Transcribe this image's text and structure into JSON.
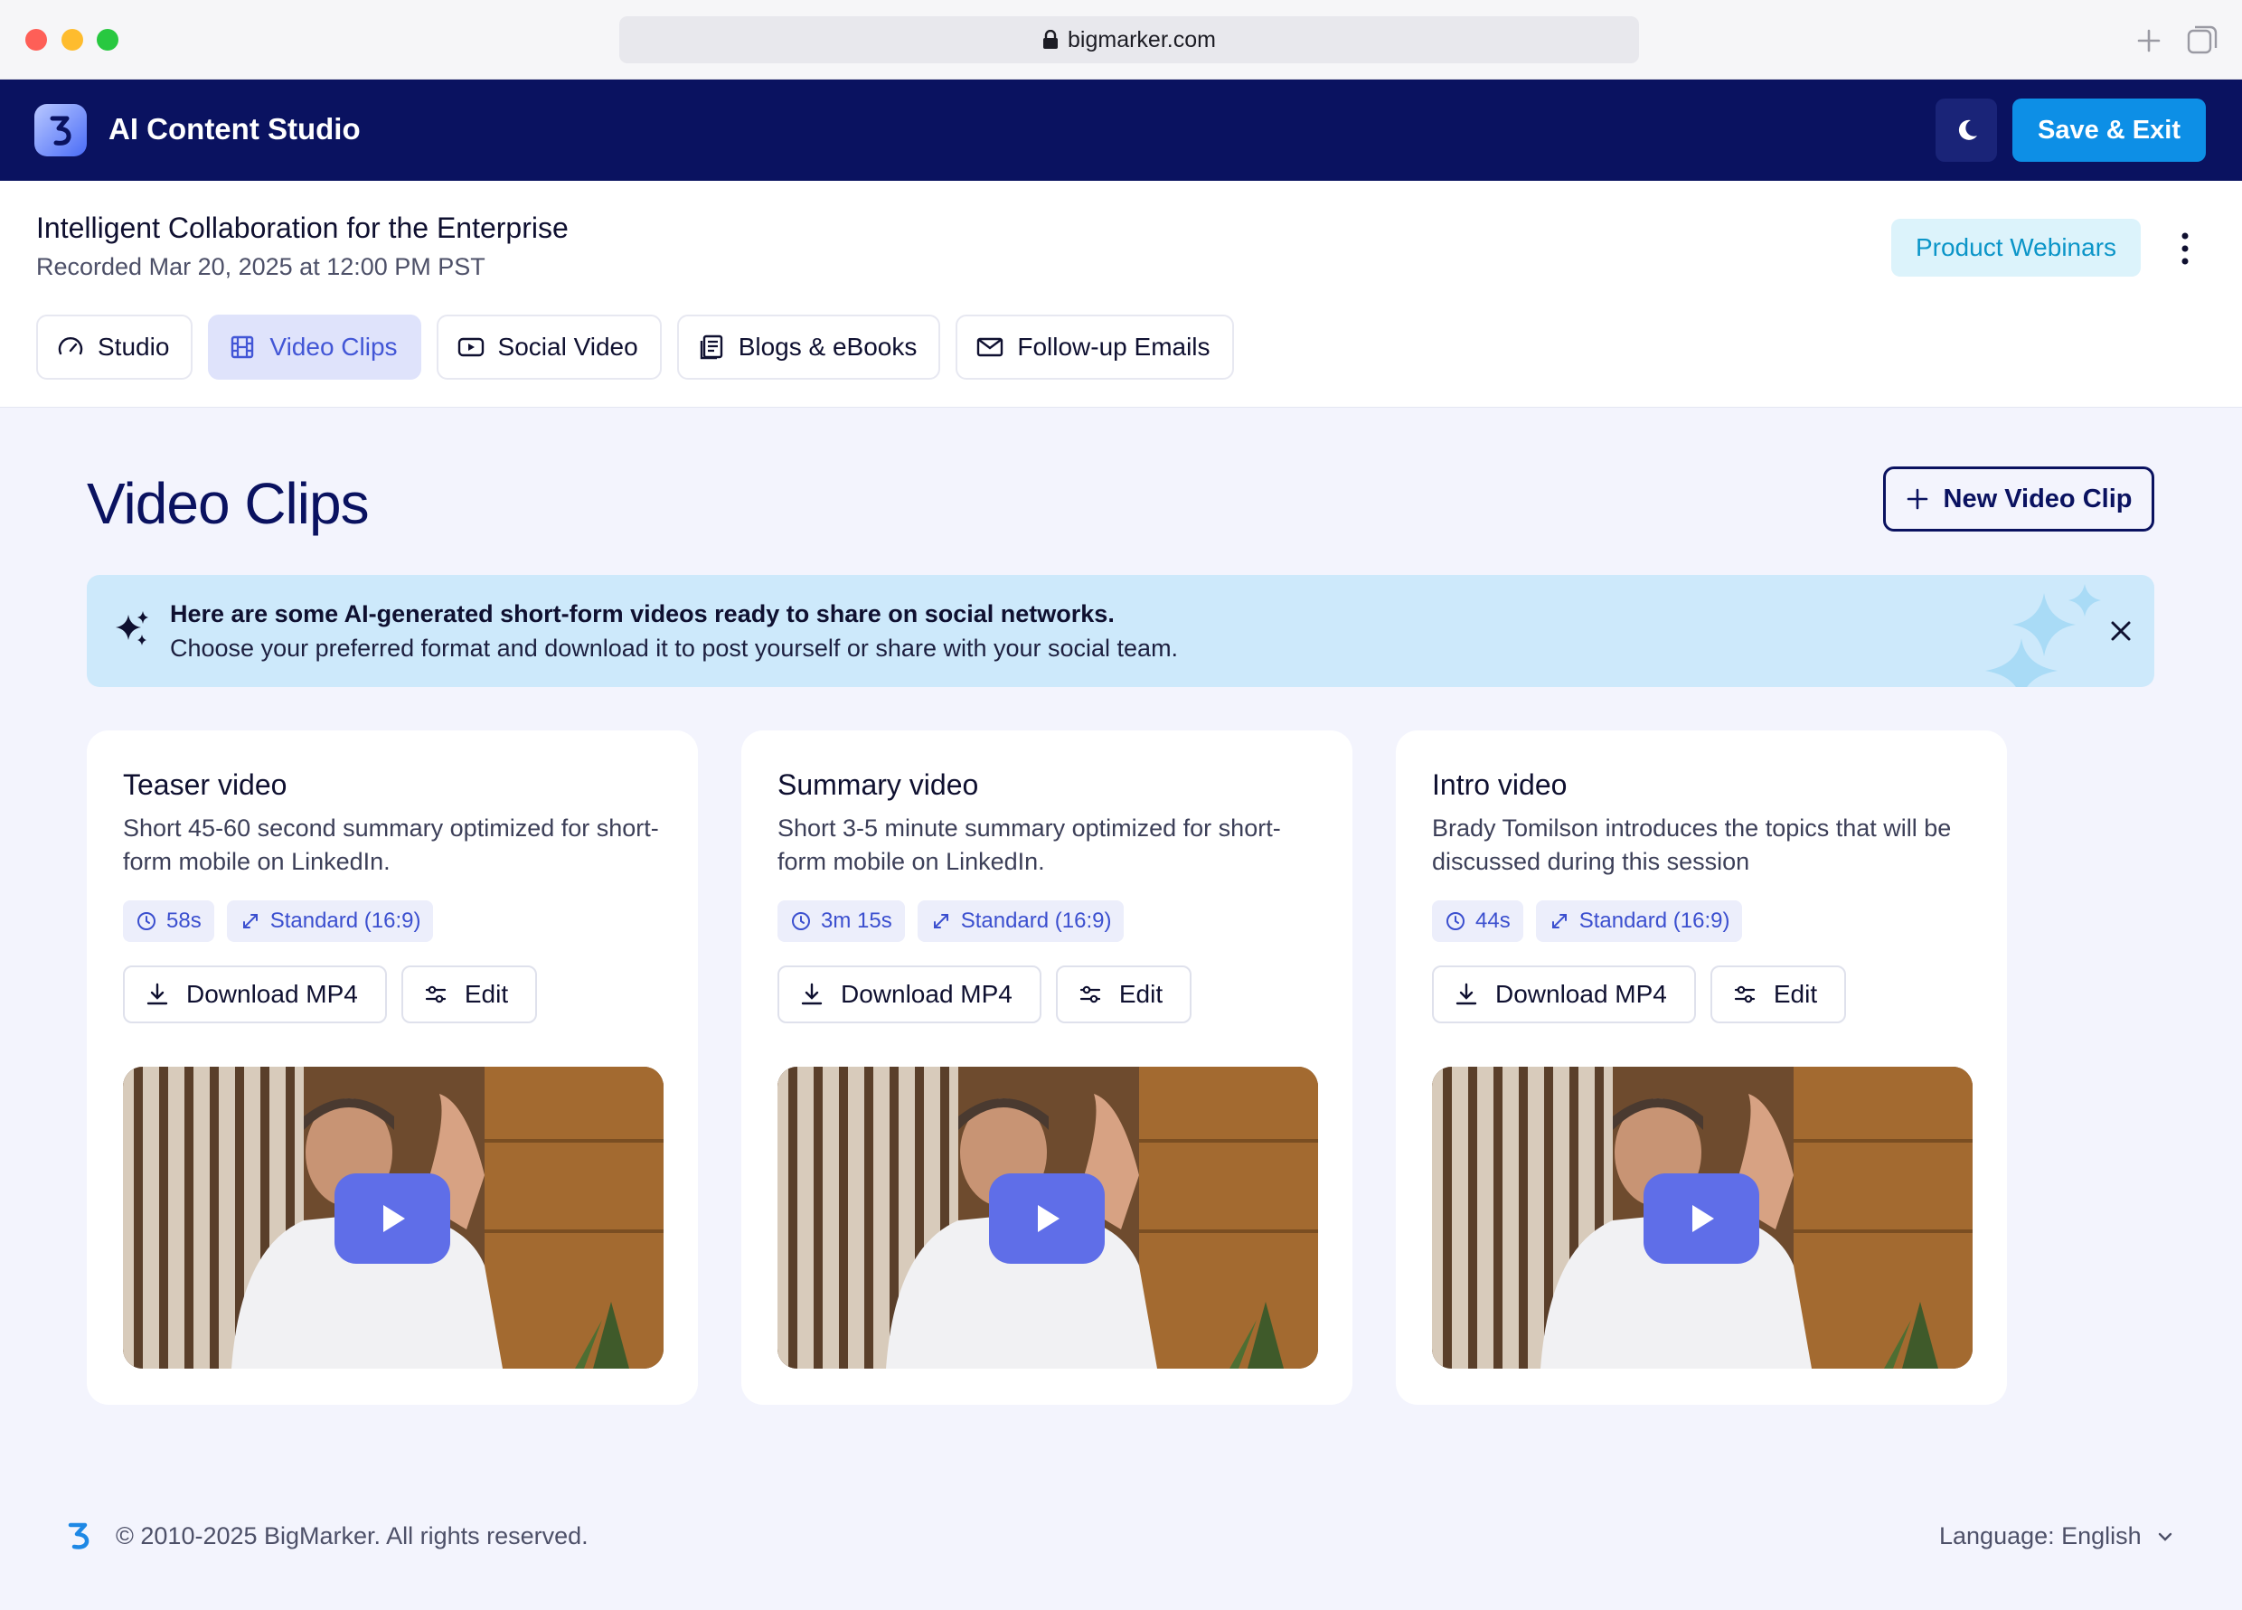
{
  "browser": {
    "url": "bigmarker.com"
  },
  "app": {
    "title": "AI Content Studio",
    "save_label": "Save & Exit",
    "colors": {
      "navbar": "#0a1260",
      "primary": "#0d8fe6",
      "accent": "#4256d6"
    }
  },
  "event": {
    "title": "Intelligent Collaboration for the Enterprise",
    "recorded": "Recorded Mar 20, 2025 at 12:00 PM PST",
    "series": "Product Webinars"
  },
  "tabs": [
    {
      "label": "Studio",
      "icon": "gauge-icon",
      "active": false
    },
    {
      "label": "Video Clips",
      "icon": "film-icon",
      "active": true
    },
    {
      "label": "Social Video",
      "icon": "play-rectangle-icon",
      "active": false
    },
    {
      "label": "Blogs & eBooks",
      "icon": "document-icon",
      "active": false
    },
    {
      "label": "Follow-up Emails",
      "icon": "envelope-icon",
      "active": false
    }
  ],
  "main": {
    "title": "Video Clips",
    "new_button": "New Video Clip"
  },
  "banner": {
    "line1": "Here are some AI-generated short-form videos ready to share on social networks.",
    "line2": "Choose your preferred format and download it to post yourself or share with your social team."
  },
  "clips": [
    {
      "title": "Teaser video",
      "description": "Short 45-60 second summary optimized for short-form mobile on LinkedIn.",
      "duration": "58s",
      "format": "Standard (16:9)",
      "download_label": "Download MP4",
      "edit_label": "Edit"
    },
    {
      "title": "Summary video",
      "description": "Short 3-5 minute summary optimized for short-form mobile on LinkedIn.",
      "duration": "3m 15s",
      "format": "Standard (16:9)",
      "download_label": "Download MP4",
      "edit_label": "Edit"
    },
    {
      "title": "Intro video",
      "description": "Brady Tomilson introduces the topics that will be discussed during this session",
      "duration": "44s",
      "format": "Standard (16:9)",
      "download_label": "Download MP4",
      "edit_label": "Edit"
    }
  ],
  "footer": {
    "copyright": "© 2010-2025 BigMarker. All rights reserved.",
    "language": "Language: English"
  }
}
